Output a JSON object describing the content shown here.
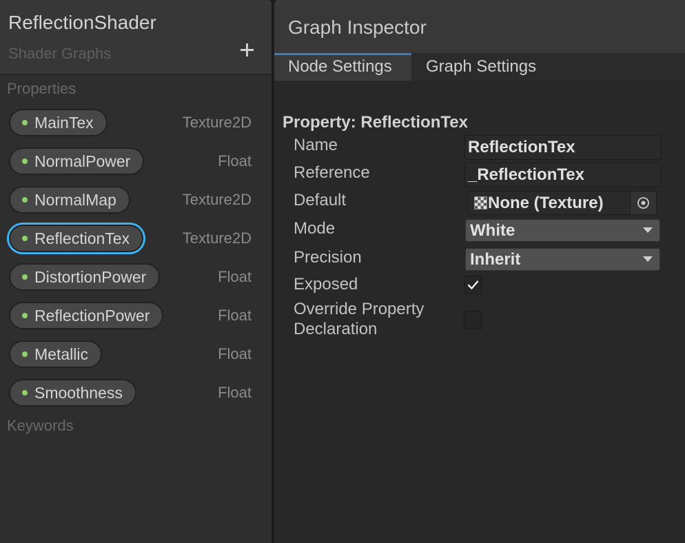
{
  "blackboard": {
    "title": "ReflectionShader",
    "subtitle": "Shader Graphs",
    "properties_section_label": "Properties",
    "keywords_section_label": "Keywords",
    "properties": [
      {
        "name": "MainTex",
        "type": "Texture2D",
        "selected": false
      },
      {
        "name": "NormalPower",
        "type": "Float",
        "selected": false
      },
      {
        "name": "NormalMap",
        "type": "Texture2D",
        "selected": false
      },
      {
        "name": "ReflectionTex",
        "type": "Texture2D",
        "selected": true
      },
      {
        "name": "DistortionPower",
        "type": "Float",
        "selected": false
      },
      {
        "name": "ReflectionPower",
        "type": "Float",
        "selected": false
      },
      {
        "name": "Metallic",
        "type": "Float",
        "selected": false
      },
      {
        "name": "Smoothness",
        "type": "Float",
        "selected": false
      }
    ]
  },
  "inspector": {
    "title": "Graph Inspector",
    "tabs": [
      {
        "label": "Node Settings",
        "active": true
      },
      {
        "label": "Graph Settings",
        "active": false
      }
    ],
    "property_heading": "Property: ReflectionTex",
    "name": {
      "label": "Name",
      "value": "ReflectionTex"
    },
    "reference": {
      "label": "Reference",
      "value": "_ReflectionTex"
    },
    "default": {
      "label": "Default",
      "value": "None (Texture)"
    },
    "mode": {
      "label": "Mode",
      "value": "White"
    },
    "precision": {
      "label": "Precision",
      "value": "Inherit"
    },
    "exposed": {
      "label": "Exposed",
      "checked": true
    },
    "override_declaration": {
      "label": "Override Property Declaration",
      "checked": false
    }
  },
  "icons": {
    "add_property": "plus-icon",
    "property_dot": "property-dot-icon",
    "default_texture": "texture-checker-icon",
    "object_picker": "object-picker-icon",
    "dropdown": "triangle-down-icon",
    "checkbox_check": "checkmark-icon"
  },
  "colors": {
    "property_dot": "#8fd16a",
    "selection_outline": "#3db1f2",
    "active_tab_accent": "#3a7bc4"
  }
}
